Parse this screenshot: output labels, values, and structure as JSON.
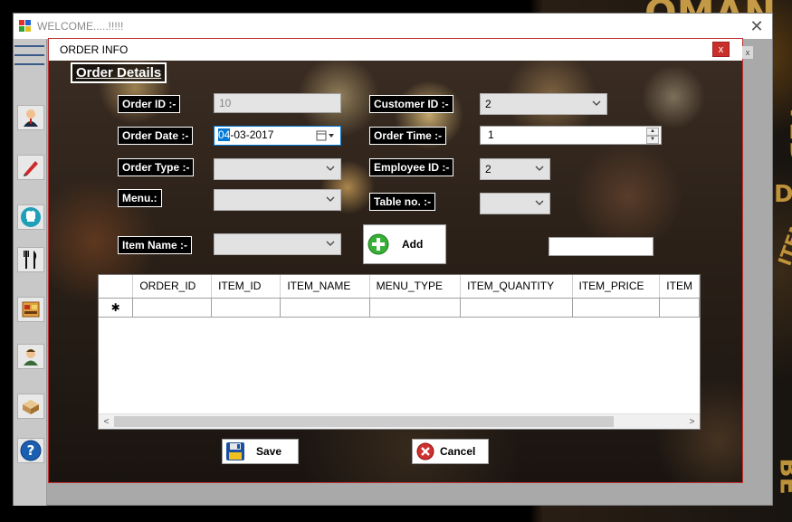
{
  "welcome_window": {
    "title": "WELCOME.....!!!!!",
    "close_glyph": "✕"
  },
  "background_words": [
    "OMAN",
    "TED",
    "ITEM",
    "D",
    "BE"
  ],
  "order_window": {
    "title": "ORDER INFO",
    "close_glyph": "x",
    "behind_close_glyph": "x"
  },
  "form": {
    "heading": "Order Details",
    "order_id": {
      "label": "Order ID :-",
      "value": "10"
    },
    "order_date": {
      "label": "Order Date :-",
      "value_selected": "04",
      "value_rest": "-03-2017"
    },
    "order_type": {
      "label": "Order Type :-",
      "value": ""
    },
    "menu": {
      "label": "Menu.:",
      "value": ""
    },
    "item_name": {
      "label": "Item Name :-",
      "value": ""
    },
    "customer_id": {
      "label": "Customer ID :-",
      "value": "2"
    },
    "order_time": {
      "label": "Order Time :-",
      "value": "1",
      "up": "▲",
      "down": "▼"
    },
    "employee_id": {
      "label": "Employee ID :-",
      "value": "2"
    },
    "table_no": {
      "label": "Table no. :-",
      "value": ""
    },
    "extra_input": {
      "value": ""
    },
    "add_button": "Add",
    "save_button": "Save",
    "cancel_button": "Cancel"
  },
  "grid": {
    "columns": [
      "ORDER_ID",
      "ITEM_ID",
      "ITEM_NAME",
      "MENU_TYPE",
      "ITEM_QUANTITY",
      "ITEM_PRICE",
      "ITEM"
    ],
    "new_row_marker": "✱",
    "scroll_left": "<",
    "scroll_right": ">"
  },
  "colors": {
    "label_bg": "#000000",
    "label_fg": "#ffffff",
    "close_red": "#c9302c",
    "date_highlight": "#0078d7"
  },
  "side_toolbar_icons": [
    "hamburger-icon",
    "customer-icon",
    "pen-icon",
    "chef-icon",
    "cutlery-icon",
    "menu-card-icon",
    "employee-icon",
    "table-icon",
    "help-icon"
  ]
}
